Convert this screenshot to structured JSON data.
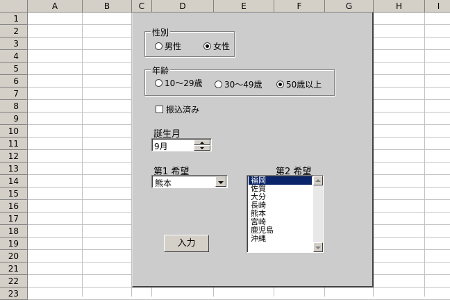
{
  "sheet": {
    "columns": [
      "A",
      "B",
      "C",
      "D",
      "E",
      "F",
      "G",
      "H",
      "I"
    ],
    "rows": [
      "1",
      "2",
      "3",
      "4",
      "5",
      "6",
      "7",
      "8",
      "9",
      "10",
      "11",
      "12",
      "13",
      "14",
      "15",
      "16",
      "17",
      "18",
      "19",
      "20",
      "21",
      "22",
      "23"
    ]
  },
  "form": {
    "gender": {
      "title": "性別",
      "options": [
        "男性",
        "女性"
      ],
      "selected": "女性"
    },
    "age": {
      "title": "年齢",
      "options": [
        "10～29歳",
        "30～49歳",
        "50歳以上"
      ],
      "selected": "50歳以上"
    },
    "paid_checkbox": {
      "label": "振込済み",
      "checked": false
    },
    "birth_month": {
      "label": "誕生月",
      "value": "9月"
    },
    "choice1": {
      "label": "第1 希望",
      "value": "熊本"
    },
    "choice2": {
      "label": "第2 希望",
      "items": [
        "福岡",
        "佐賀",
        "大分",
        "長崎",
        "熊本",
        "宮崎",
        "鹿児島",
        "沖縄"
      ],
      "selected": "福岡"
    },
    "submit_label": "入力"
  },
  "colors": {
    "form_bg": "#cccccc",
    "selection": "#0a246a",
    "header_bg": "#d4d0c8"
  }
}
